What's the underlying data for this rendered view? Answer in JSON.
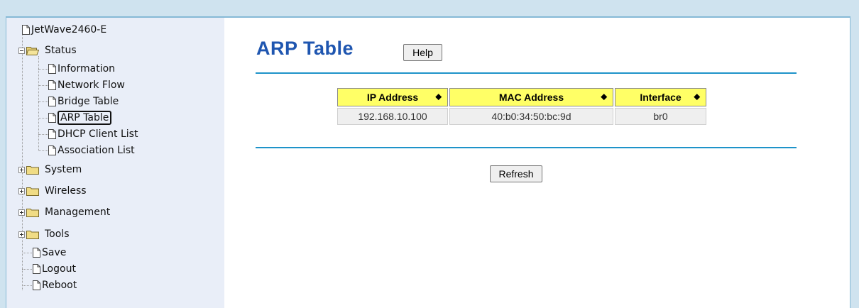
{
  "sidebar": {
    "root_label": "JetWave2460-E",
    "status": {
      "label": "Status",
      "children": [
        {
          "label": "Information"
        },
        {
          "label": "Network Flow"
        },
        {
          "label": "Bridge Table"
        },
        {
          "label": "ARP Table",
          "selected": true
        },
        {
          "label": "DHCP Client List"
        },
        {
          "label": "Association List"
        }
      ]
    },
    "folders": [
      {
        "label": "System"
      },
      {
        "label": "Wireless"
      },
      {
        "label": "Management"
      },
      {
        "label": "Tools"
      }
    ],
    "actions": [
      {
        "label": "Save"
      },
      {
        "label": "Logout"
      },
      {
        "label": "Reboot"
      }
    ]
  },
  "main": {
    "title": "ARP Table",
    "help_label": "Help",
    "refresh_label": "Refresh",
    "table": {
      "columns": [
        "IP Address",
        "MAC Address",
        "Interface"
      ],
      "rows": [
        [
          "192.168.10.100",
          "40:b0:34:50:bc:9d",
          "br0"
        ]
      ]
    }
  },
  "colors": {
    "title": "#1f56b0",
    "header_bg": "#ffff66",
    "rule": "#1e93c9",
    "sidebar_bg": "#e9eef8",
    "page_bg": "#cfe3ef"
  },
  "icons": {
    "page": "document-icon",
    "folder": "folder-icon",
    "expand": "plus-box-icon",
    "collapse": "minus-box-icon",
    "sort": "sort-arrows-icon"
  }
}
